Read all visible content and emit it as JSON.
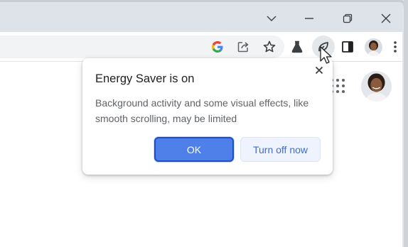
{
  "window": {
    "controls": [
      "tab-search",
      "minimize",
      "restore",
      "close"
    ]
  },
  "toolbar": {
    "icons": [
      "google-icon",
      "share-icon",
      "bookmark-star-icon",
      "labs-flask-icon",
      "energy-saver-icon",
      "side-panel-icon",
      "profile-avatar",
      "more-menu-icon"
    ]
  },
  "popup": {
    "title": "Energy Saver is on",
    "body": "Background activity and some visual effects, like smooth scrolling, may be limited",
    "ok_label": "OK",
    "turn_off_label": "Turn off now"
  },
  "colors": {
    "accent": "#1a73e8",
    "ok_button": "#4f7fe8",
    "secondary_button_bg": "#eef3fd",
    "titlebar": "#dee3e9"
  }
}
